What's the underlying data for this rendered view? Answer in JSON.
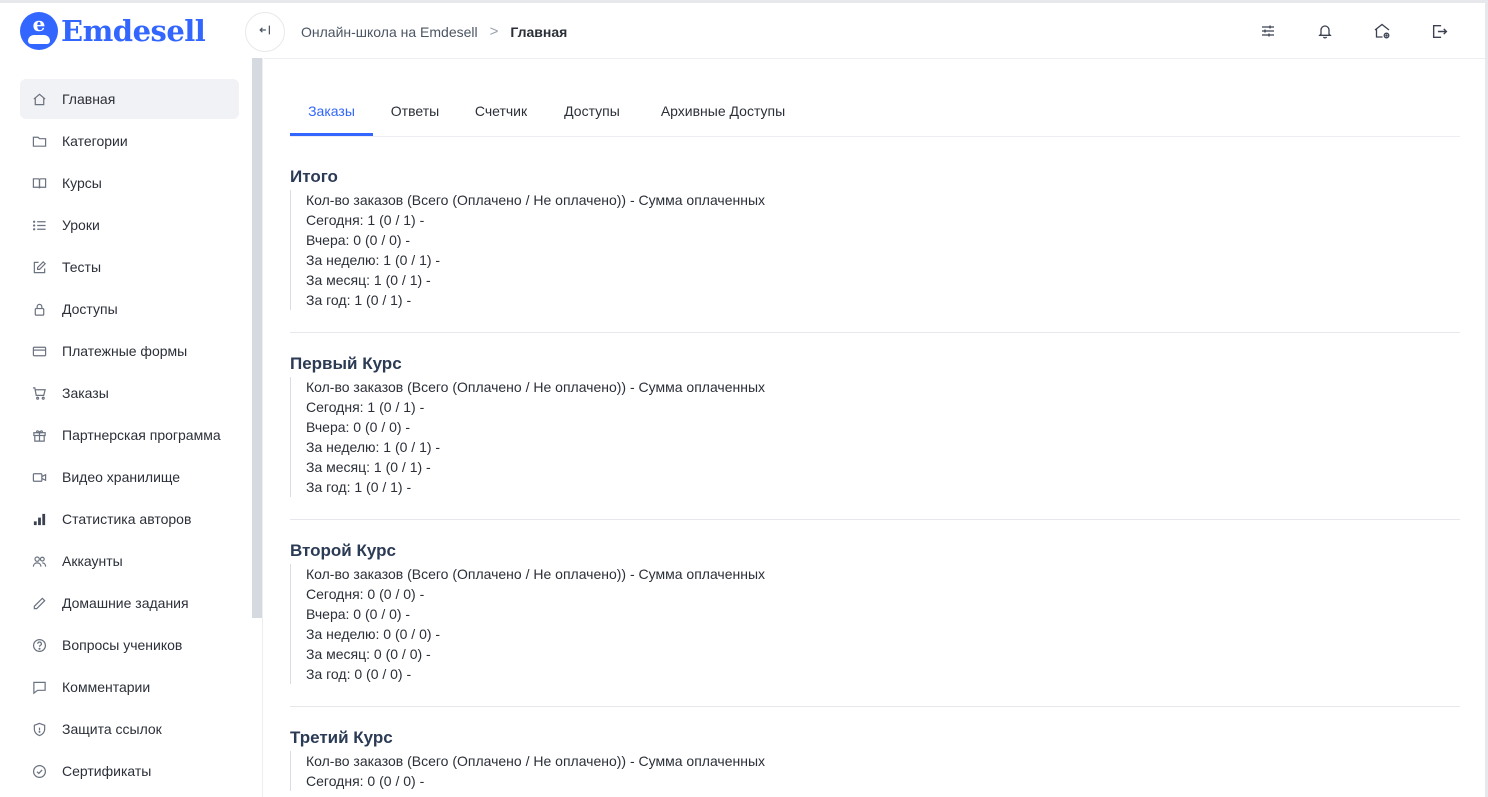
{
  "brand": {
    "name": "Emdesell",
    "mark_letter": "e",
    "color": "#3366ff"
  },
  "header": {
    "breadcrumb": {
      "link": "Онлайн-школа на Emdesell",
      "separator": ">",
      "current": "Главная"
    },
    "icons": [
      "sliders-icon",
      "bell-icon",
      "home-settings-icon",
      "logout-icon"
    ]
  },
  "sidebar": {
    "items": [
      {
        "label": "Главная",
        "icon": "home-icon",
        "active": true
      },
      {
        "label": "Категории",
        "icon": "folder-icon"
      },
      {
        "label": "Курсы",
        "icon": "book-icon"
      },
      {
        "label": "Уроки",
        "icon": "list-icon"
      },
      {
        "label": "Тесты",
        "icon": "edit-icon"
      },
      {
        "label": "Доступы",
        "icon": "lock-icon"
      },
      {
        "label": "Платежные формы",
        "icon": "credit-card-icon"
      },
      {
        "label": "Заказы",
        "icon": "cart-icon"
      },
      {
        "label": "Партнерская программа",
        "icon": "gift-icon"
      },
      {
        "label": "Видео хранилище",
        "icon": "video-icon"
      },
      {
        "label": "Статистика авторов",
        "icon": "bar-chart-icon"
      },
      {
        "label": "Аккаунты",
        "icon": "users-icon"
      },
      {
        "label": "Домашние задания",
        "icon": "pencil-icon"
      },
      {
        "label": "Вопросы учеников",
        "icon": "question-icon"
      },
      {
        "label": "Комментарии",
        "icon": "comment-icon"
      },
      {
        "label": "Защита ссылок",
        "icon": "shield-icon"
      },
      {
        "label": "Сертификаты",
        "icon": "certificate-icon"
      }
    ]
  },
  "tabs": [
    {
      "label": "Заказы",
      "active": true
    },
    {
      "label": "Ответы"
    },
    {
      "label": "Счетчик"
    },
    {
      "label": "Доступы"
    },
    {
      "label": "Архивные Доступы"
    }
  ],
  "sections": [
    {
      "title": "Итого",
      "lines": [
        "Кол-во заказов (Всего (Оплачено / Не оплачено)) - Сумма оплаченных",
        "Сегодня: 1 (0 / 1) -",
        "Вчера: 0 (0 / 0) -",
        "За неделю: 1 (0 / 1) -",
        "За месяц: 1 (0 / 1) -",
        "За год: 1 (0 / 1) -"
      ]
    },
    {
      "title": "Первый Курс",
      "lines": [
        "Кол-во заказов (Всего (Оплачено / Не оплачено)) - Сумма оплаченных",
        "Сегодня: 1 (0 / 1) -",
        "Вчера: 0 (0 / 0) -",
        "За неделю: 1 (0 / 1) -",
        "За месяц: 1 (0 / 1) -",
        "За год: 1 (0 / 1) -"
      ]
    },
    {
      "title": "Второй Курс",
      "lines": [
        "Кол-во заказов (Всего (Оплачено / Не оплачено)) - Сумма оплаченных",
        "Сегодня: 0 (0 / 0) -",
        "Вчера: 0 (0 / 0) -",
        "За неделю: 0 (0 / 0) -",
        "За месяц: 0 (0 / 0) -",
        "За год: 0 (0 / 0) -"
      ]
    },
    {
      "title": "Третий Курс",
      "lines": [
        "Кол-во заказов (Всего (Оплачено / Не оплачено)) - Сумма оплаченных",
        "Сегодня: 0 (0 / 0) -"
      ]
    }
  ]
}
